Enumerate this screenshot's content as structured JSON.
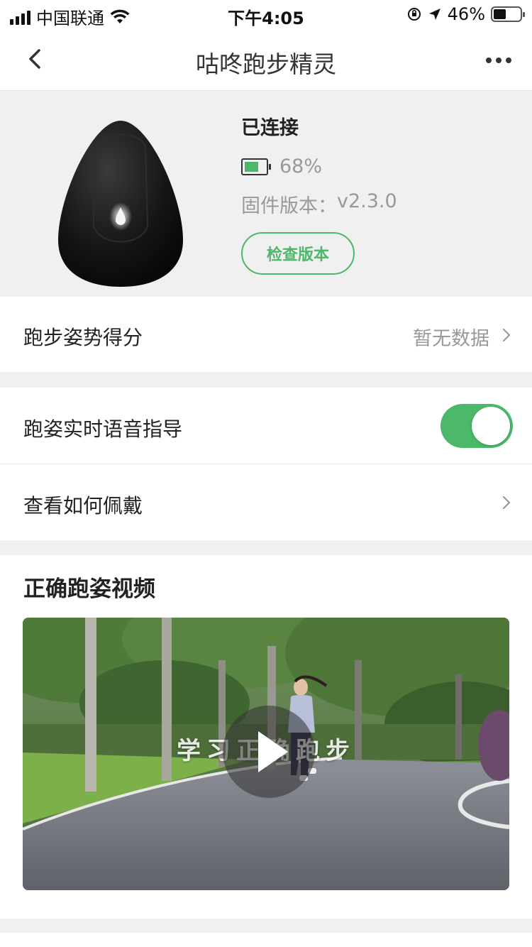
{
  "status_bar": {
    "carrier": "中国联通",
    "time": "下午4:05",
    "battery_text": "46%",
    "battery_level": 0.46
  },
  "nav": {
    "title": "咕咚跑步精灵"
  },
  "device": {
    "status": "已连接",
    "battery_percent": "68%",
    "battery_level": 0.68,
    "firmware_label": "固件版本：",
    "firmware_version": "v2.3.0",
    "check_button": "检查版本"
  },
  "rows": {
    "score_label": "跑步姿势得分",
    "score_value": "暂无数据",
    "voice_label": "跑姿实时语音指导",
    "voice_enabled": true,
    "wear_label": "查看如何佩戴"
  },
  "video": {
    "section_title": "正确跑姿视频",
    "caption": "学习正确跑步"
  },
  "colors": {
    "accent": "#4cb86a",
    "background": "#f0f0f0",
    "text_secondary": "#999999"
  }
}
